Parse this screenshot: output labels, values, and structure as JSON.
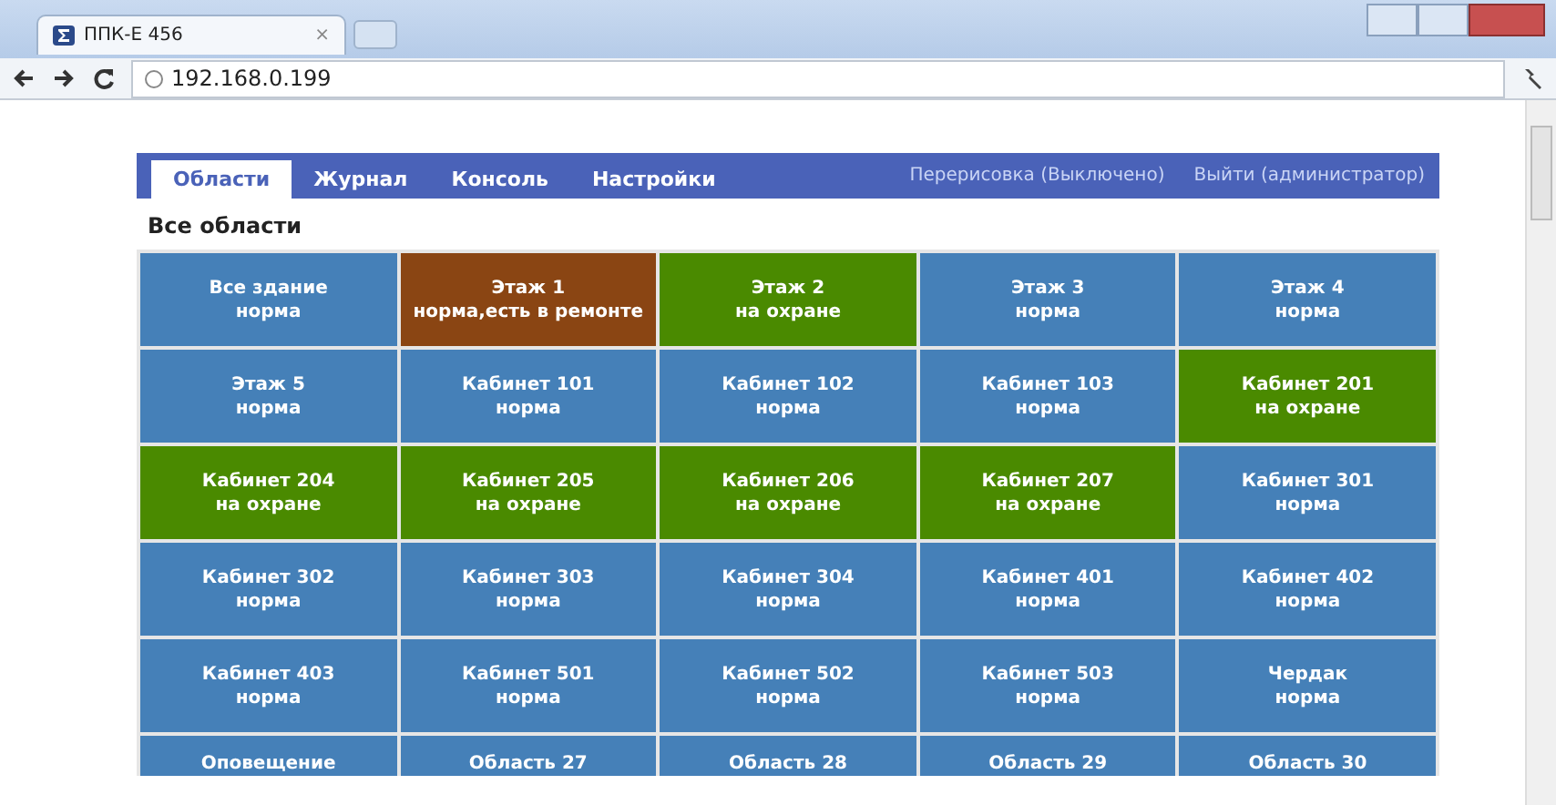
{
  "browser": {
    "tab_title": "ППК-Е 456",
    "tab_close": "×",
    "address": "192.168.0.199"
  },
  "nav": {
    "tabs": [
      {
        "label": "Области",
        "selected": true
      },
      {
        "label": "Журнал",
        "selected": false
      },
      {
        "label": "Консоль",
        "selected": false
      },
      {
        "label": "Настройки",
        "selected": false
      }
    ],
    "links": [
      "Перерисовка (Выключено)",
      "Выйти (администратор)"
    ]
  },
  "heading": "Все области",
  "areas": [
    {
      "name": "Все здание",
      "status": "норма",
      "color": "#4580b8"
    },
    {
      "name": "Этаж 1",
      "status": "норма,есть в ремонте",
      "color": "#8a4513"
    },
    {
      "name": "Этаж 2",
      "status": "на охране",
      "color": "#4a8a00"
    },
    {
      "name": "Этаж 3",
      "status": "норма",
      "color": "#4580b8"
    },
    {
      "name": "Этаж 4",
      "status": "норма",
      "color": "#4580b8"
    },
    {
      "name": "Этаж 5",
      "status": "норма",
      "color": "#4580b8"
    },
    {
      "name": "Кабинет 101",
      "status": "норма",
      "color": "#4580b8"
    },
    {
      "name": "Кабинет 102",
      "status": "норма",
      "color": "#4580b8"
    },
    {
      "name": "Кабинет 103",
      "status": "норма",
      "color": "#4580b8"
    },
    {
      "name": "Кабинет 201",
      "status": "на охране",
      "color": "#4a8a00"
    },
    {
      "name": "Кабинет 204",
      "status": "на охране",
      "color": "#4a8a00"
    },
    {
      "name": "Кабинет 205",
      "status": "на охране",
      "color": "#4a8a00"
    },
    {
      "name": "Кабинет 206",
      "status": "на охране",
      "color": "#4a8a00"
    },
    {
      "name": "Кабинет 207",
      "status": "на охране",
      "color": "#4a8a00"
    },
    {
      "name": "Кабинет 301",
      "status": "норма",
      "color": "#4580b8"
    },
    {
      "name": "Кабинет 302",
      "status": "норма",
      "color": "#4580b8"
    },
    {
      "name": "Кабинет 303",
      "status": "норма",
      "color": "#4580b8"
    },
    {
      "name": "Кабинет 304",
      "status": "норма",
      "color": "#4580b8"
    },
    {
      "name": "Кабинет 401",
      "status": "норма",
      "color": "#4580b8"
    },
    {
      "name": "Кабинет 402",
      "status": "норма",
      "color": "#4580b8"
    },
    {
      "name": "Кабинет 403",
      "status": "норма",
      "color": "#4580b8"
    },
    {
      "name": "Кабинет 501",
      "status": "норма",
      "color": "#4580b8"
    },
    {
      "name": "Кабинет 502",
      "status": "норма",
      "color": "#4580b8"
    },
    {
      "name": "Кабинет 503",
      "status": "норма",
      "color": "#4580b8"
    },
    {
      "name": "Чердак",
      "status": "норма",
      "color": "#4580b8"
    },
    {
      "name": "Оповещение",
      "color": "#4580b8"
    },
    {
      "name": "Область 27",
      "color": "#4580b8"
    },
    {
      "name": "Область 28",
      "color": "#4580b8"
    },
    {
      "name": "Область 29",
      "color": "#4580b8"
    },
    {
      "name": "Область 30",
      "color": "#4580b8"
    }
  ]
}
